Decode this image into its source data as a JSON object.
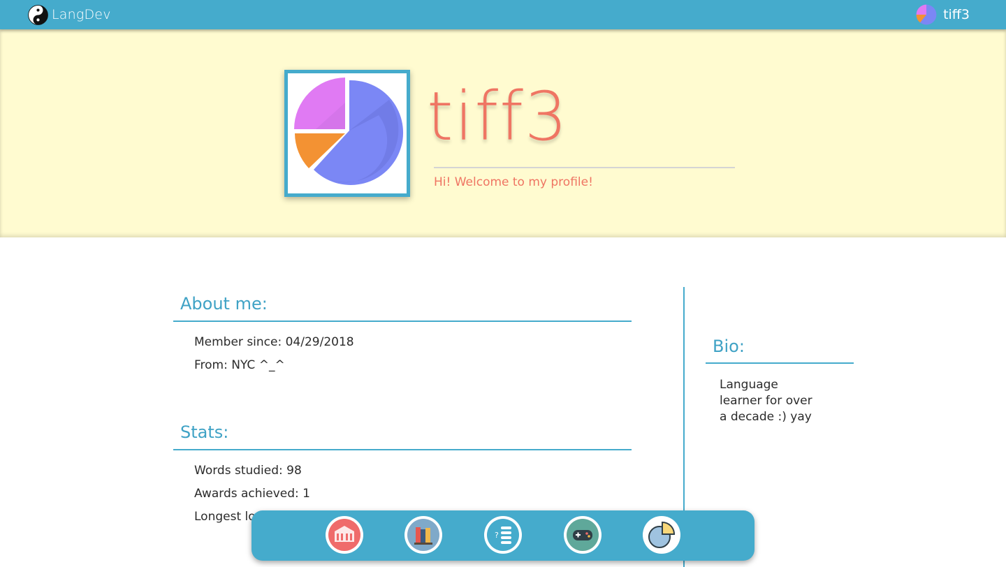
{
  "nav": {
    "brand_name": "LangDev",
    "brand_icon": "yin-yang-icon",
    "user_name": "tiff3",
    "user_avatar": "pie-chart-avatar-icon"
  },
  "profile": {
    "username": "tiff3",
    "tagline": "Hi! Welcome to my profile!",
    "avatar_icon": "pie-chart-icon"
  },
  "about": {
    "title": "About me:",
    "member_since": "Member since: 04/29/2018",
    "from": "From: NYC ^_^"
  },
  "stats": {
    "title": "Stats:",
    "words_studied": "Words studied: 98",
    "awards_achieved": "Awards achieved: 1",
    "longest_partial": "Longest lo"
  },
  "bio": {
    "title": "Bio:",
    "line1": "Language",
    "line2": "learner for over",
    "line3": "a decade :) yay"
  },
  "dock": {
    "items": [
      {
        "name": "building-icon"
      },
      {
        "name": "books-icon"
      },
      {
        "name": "quiz-list-icon"
      },
      {
        "name": "gamepad-icon"
      },
      {
        "name": "pie-chart-icon"
      }
    ]
  },
  "colors": {
    "primary": "#45abcc",
    "banner_bg": "#fffbd0",
    "accent": "#ef7563",
    "heading": "#3fa2c5"
  }
}
